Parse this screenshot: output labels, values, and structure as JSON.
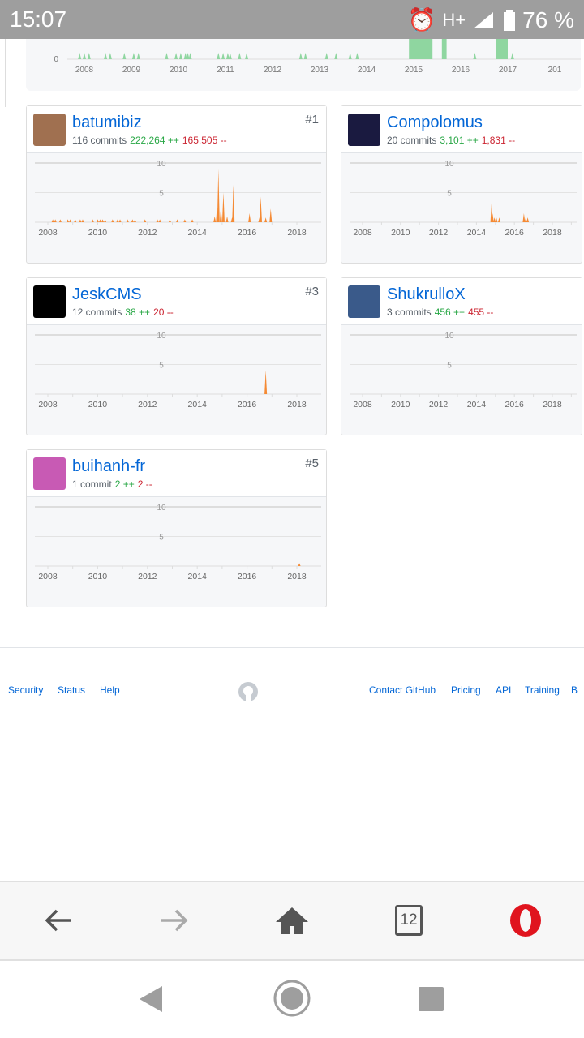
{
  "status_bar": {
    "time": "15:07",
    "network": "H+",
    "battery": "76 %"
  },
  "top_chart": {
    "zero_label": "0",
    "years": [
      "2008",
      "2009",
      "2010",
      "2011",
      "2012",
      "2013",
      "2014",
      "2015",
      "2016",
      "2017",
      "201"
    ],
    "color": "#8fd6a0"
  },
  "contributors": [
    {
      "name": "batumibiz",
      "commits": "116 commits",
      "additions": "222,264 ++",
      "deletions": "165,505 --",
      "rank": "#1",
      "avatar_color": "#a07050",
      "spikes": [
        [
          2008.2,
          0.5
        ],
        [
          2008.3,
          0.5
        ],
        [
          2008.5,
          0.5
        ],
        [
          2008.8,
          0.5
        ],
        [
          2008.9,
          0.5
        ],
        [
          2009.1,
          0.5
        ],
        [
          2009.3,
          0.5
        ],
        [
          2009.4,
          0.5
        ],
        [
          2009.8,
          0.5
        ],
        [
          2010.0,
          0.5
        ],
        [
          2010.1,
          0.5
        ],
        [
          2010.2,
          0.5
        ],
        [
          2010.3,
          0.5
        ],
        [
          2010.6,
          0.5
        ],
        [
          2010.8,
          0.5
        ],
        [
          2010.9,
          0.5
        ],
        [
          2011.2,
          0.5
        ],
        [
          2011.4,
          0.5
        ],
        [
          2011.5,
          0.5
        ],
        [
          2011.9,
          0.5
        ],
        [
          2012.4,
          0.5
        ],
        [
          2012.5,
          0.5
        ],
        [
          2012.9,
          0.5
        ],
        [
          2013.2,
          0.5
        ],
        [
          2013.5,
          0.5
        ],
        [
          2013.8,
          0.5
        ],
        [
          2014.7,
          1
        ],
        [
          2014.8,
          3
        ],
        [
          2014.85,
          9
        ],
        [
          2014.95,
          2.5
        ],
        [
          2015.05,
          5
        ],
        [
          2015.2,
          1
        ],
        [
          2015.4,
          0.8
        ],
        [
          2015.45,
          6.3
        ],
        [
          2016.1,
          1.5
        ],
        [
          2016.5,
          0.8
        ],
        [
          2016.55,
          4.3
        ],
        [
          2016.75,
          0.8
        ],
        [
          2016.95,
          2.3
        ]
      ]
    },
    {
      "name": "Compolomus",
      "commits": "20 commits",
      "additions": "3,101 ++",
      "deletions": "1,831 --",
      "rank": "",
      "avatar_color": "#1a1a40",
      "spikes": [
        [
          2014.8,
          3.5
        ],
        [
          2014.85,
          1.5
        ],
        [
          2014.95,
          0.8
        ],
        [
          2015.05,
          0.8
        ],
        [
          2015.2,
          0.8
        ],
        [
          2016.5,
          1.5
        ],
        [
          2016.6,
          0.8
        ],
        [
          2016.7,
          0.8
        ]
      ]
    },
    {
      "name": "JeskCMS",
      "commits": "12 commits",
      "additions": "38 ++",
      "deletions": "20 --",
      "rank": "#3",
      "avatar_color": "#000000",
      "spikes": [
        [
          2016.75,
          4
        ]
      ]
    },
    {
      "name": "ShukrulloX",
      "commits": "3 commits",
      "additions": "456 ++",
      "deletions": "455 --",
      "rank": "",
      "avatar_color": "#3a5a8a",
      "spikes": []
    },
    {
      "name": "buihanh-fr",
      "commits": "1 commit",
      "additions": "2 ++",
      "deletions": "2 --",
      "rank": "#5",
      "avatar_color": "#c85ab4",
      "spikes": [
        [
          2018.1,
          0.5
        ]
      ]
    }
  ],
  "chart_axis": {
    "y_ticks": [
      "10",
      "5"
    ],
    "x_ticks": [
      "2008",
      "2010",
      "2012",
      "2014",
      "2016",
      "2018"
    ],
    "color": "#f58a34"
  },
  "footer": {
    "left_links": [
      "Security",
      "Status",
      "Help"
    ],
    "right_links": [
      "Contact GitHub",
      "Pricing",
      "API",
      "Training",
      "B"
    ]
  },
  "browser_toolbar": {
    "tabs_count": "12"
  }
}
